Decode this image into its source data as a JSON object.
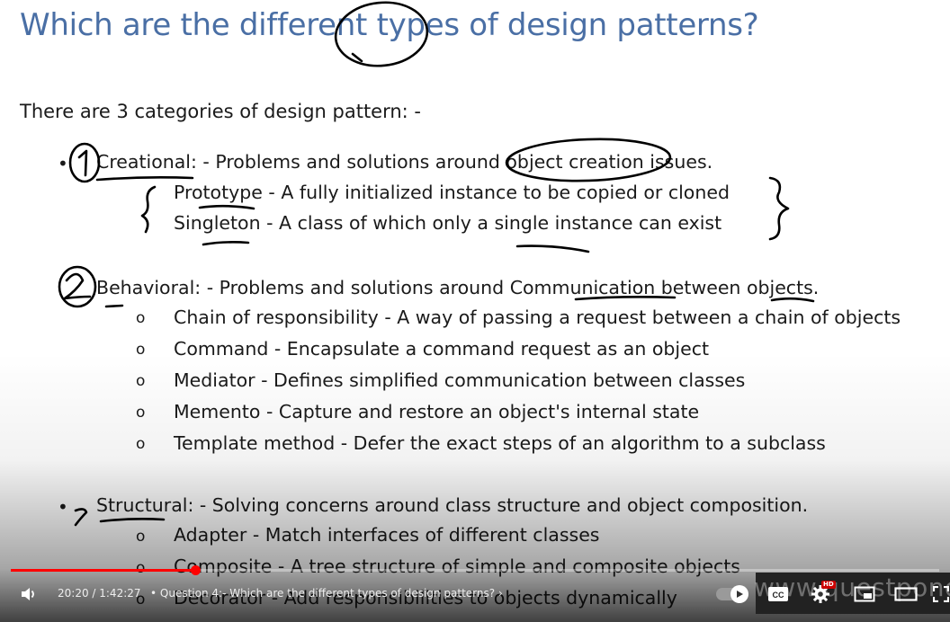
{
  "slide": {
    "title": "Which are the different types of design patterns?",
    "intro": "There are 3 categories of design pattern: -",
    "bullet_symbol": "•",
    "sub_bullet_symbol": "o",
    "categories": [
      {
        "name": "Creational: - Problems and solutions around object creation issues.",
        "items": [
          "Prototype - A fully initialized instance to be copied or cloned",
          "Singleton - A class of which only a single instance can exist"
        ]
      },
      {
        "name": "Behavioral: - Problems and solutions around Communication between objects.",
        "items": [
          "Chain of responsibility - A way of passing a request between a chain of objects",
          "Command - Encapsulate a command request as an object",
          "Mediator - Defines simplified communication between classes",
          "Memento - Capture and restore an object's internal state",
          "Template method - Defer the exact steps of an algorithm to a subclass"
        ]
      },
      {
        "name": "Structural: - Solving concerns around class structure and object composition.",
        "items": [
          "Adapter - Match interfaces of different classes",
          "Composite - A tree structure of simple and composite objects",
          "Decorator - Add responsibilities to objects dynamically"
        ]
      }
    ]
  },
  "player": {
    "time_display": "20:20 / 1:42:27",
    "chapter_separator": "•",
    "chapter_title": "Question 4:- Which are the different types of design patterns?",
    "chapter_chevron": "›",
    "progress_fraction": 0.1984,
    "watermark": "www.questpond",
    "hd_badge": "HD",
    "icons": {
      "volume": "volume-icon",
      "autoplay": "autoplay-toggle-icon",
      "captions": "captions-icon",
      "settings": "gear-icon",
      "miniplayer": "miniplayer-icon",
      "theater": "theater-mode-icon",
      "fullscreen": "fullscreen-icon"
    },
    "colors": {
      "progress": "#ff0000",
      "title": "#4a6fa5"
    }
  }
}
